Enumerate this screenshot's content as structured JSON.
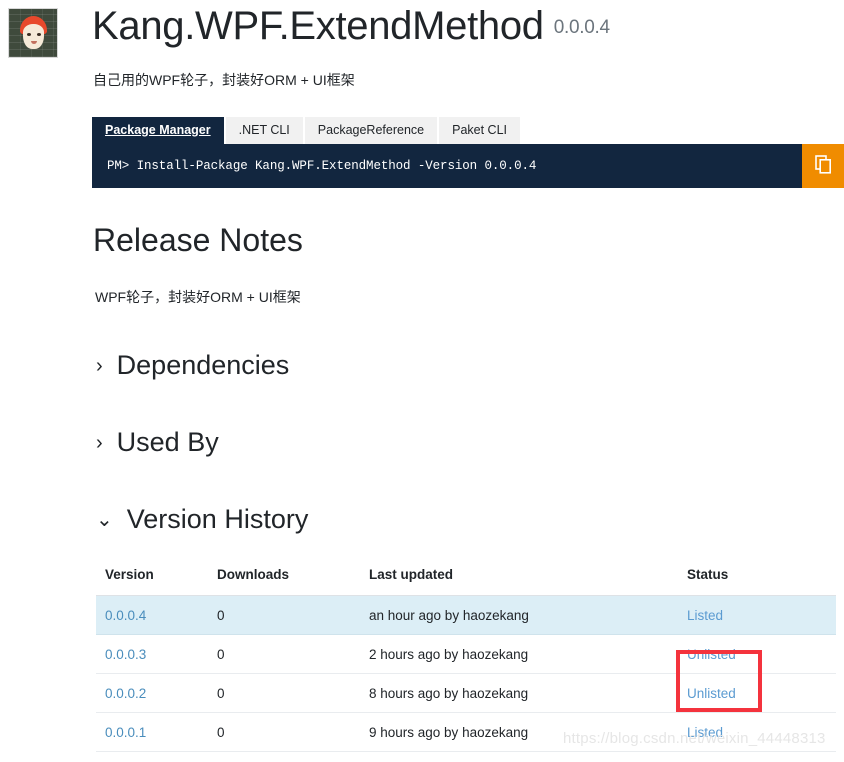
{
  "package": {
    "title": "Kang.WPF.ExtendMethod",
    "version": "0.0.0.4",
    "description": "自己用的WPF轮子，封装好ORM + UI框架",
    "avatar_icon": "user-avatar-image"
  },
  "install": {
    "tabs": [
      {
        "label": "Package Manager",
        "active": true
      },
      {
        "label": ".NET CLI",
        "active": false
      },
      {
        "label": "PackageReference",
        "active": false
      },
      {
        "label": "Paket CLI",
        "active": false
      }
    ],
    "command": "PM> Install-Package Kang.WPF.ExtendMethod -Version 0.0.0.4",
    "copy_icon": "copy-icon",
    "copy_label": "Copy"
  },
  "release_notes": {
    "heading": "Release Notes",
    "body": "WPF轮子，封装好ORM + UI框架"
  },
  "sections": [
    {
      "id": "dependencies",
      "label": "Dependencies",
      "expanded": false,
      "chevron": "chevron-right-icon",
      "glyph": "›"
    },
    {
      "id": "usedby",
      "label": "Used By",
      "expanded": false,
      "chevron": "chevron-right-icon",
      "glyph": "›"
    },
    {
      "id": "versions",
      "label": "Version History",
      "expanded": true,
      "chevron": "chevron-down-icon",
      "glyph": "⌄"
    }
  ],
  "version_history": {
    "columns": [
      "Version",
      "Downloads",
      "Last updated",
      "Status"
    ],
    "rows": [
      {
        "version": "0.0.0.4",
        "downloads": "0",
        "last_updated": "an hour ago by haozekang",
        "status": "Listed",
        "current": true
      },
      {
        "version": "0.0.0.3",
        "downloads": "0",
        "last_updated": "2 hours ago by haozekang",
        "status": "Unlisted",
        "current": false
      },
      {
        "version": "0.0.0.2",
        "downloads": "0",
        "last_updated": "8 hours ago by haozekang",
        "status": "Unlisted",
        "current": false
      },
      {
        "version": "0.0.0.1",
        "downloads": "0",
        "last_updated": "9 hours ago by haozekang",
        "status": "Listed",
        "current": false
      }
    ]
  },
  "annotation": {
    "type": "red-rectangle-highlight",
    "color": "#f4333d",
    "targets": [
      "0.0.0.3 status",
      "0.0.0.2 status"
    ]
  },
  "watermark": {
    "text": "https://blog.csdn.net/weixin_44448313"
  },
  "colors": {
    "navy": "#12263f",
    "orange": "#f08c00",
    "link_blue": "#4a8dbc",
    "status_blue": "#5b9bd1",
    "row_highlight": "#dceef6",
    "annotation_red": "#f4333d"
  }
}
